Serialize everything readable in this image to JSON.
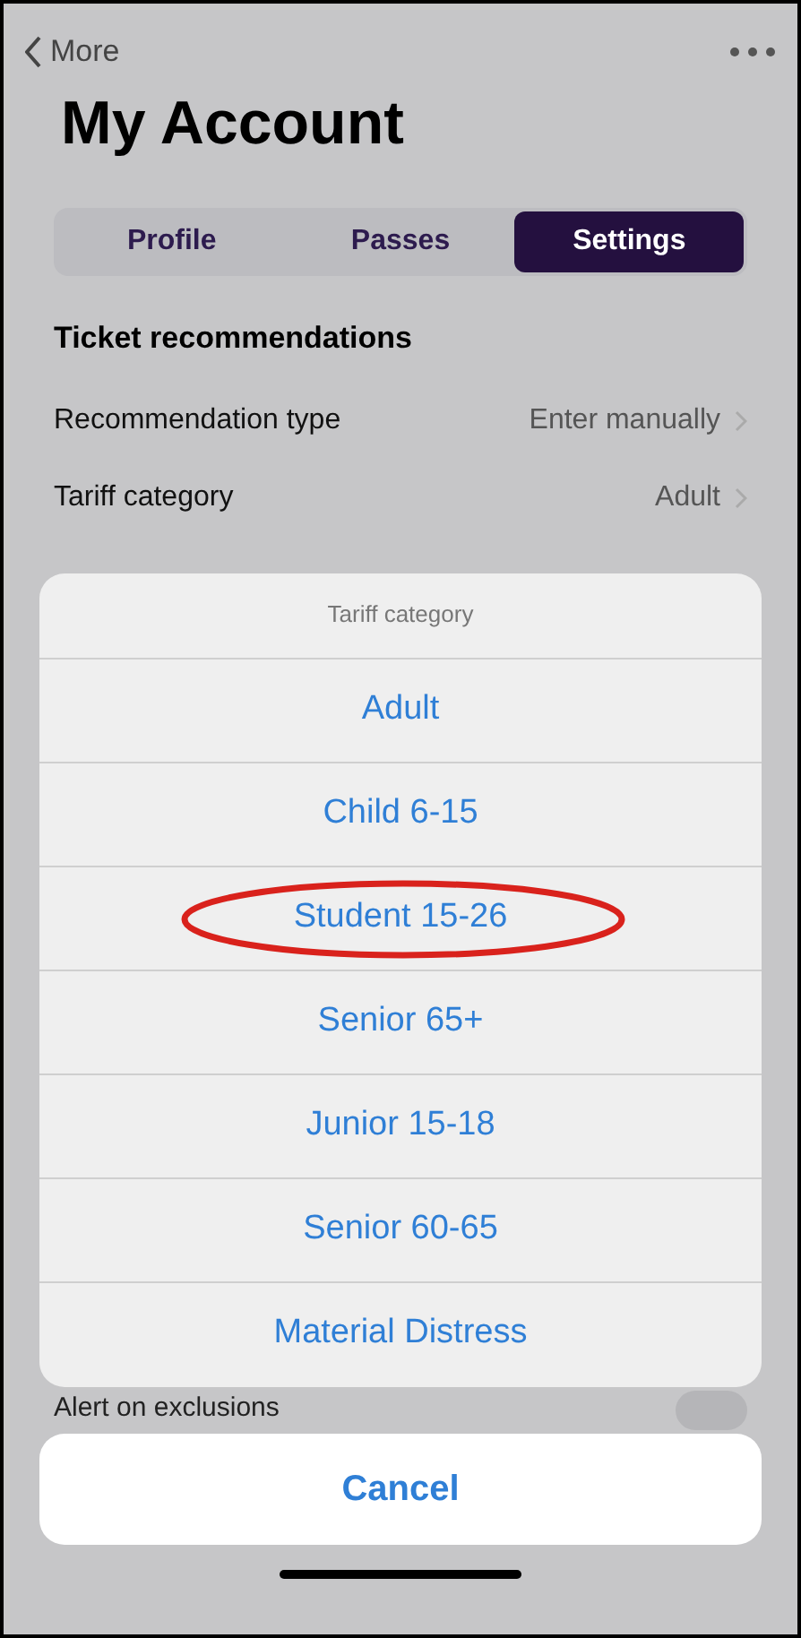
{
  "nav": {
    "back_label": "More"
  },
  "title": "My Account",
  "tabs": [
    {
      "label": "Profile",
      "selected": false
    },
    {
      "label": "Passes",
      "selected": false
    },
    {
      "label": "Settings",
      "selected": true
    }
  ],
  "section_title": "Ticket recommendations",
  "rows": [
    {
      "label": "Recommendation type",
      "value": "Enter manually"
    },
    {
      "label": "Tariff category",
      "value": "Adult"
    }
  ],
  "sheet": {
    "title": "Tariff category",
    "options": [
      {
        "label": "Adult",
        "circled": false
      },
      {
        "label": "Child 6-15",
        "circled": false
      },
      {
        "label": "Student 15-26",
        "circled": true
      },
      {
        "label": "Senior 65+",
        "circled": false
      },
      {
        "label": "Junior 15-18",
        "circled": false
      },
      {
        "label": "Senior 60-65",
        "circled": false
      },
      {
        "label": "Material Distress",
        "circled": false
      }
    ],
    "cancel": "Cancel"
  },
  "background_row": {
    "label": "Alert on exclusions",
    "on": false
  }
}
